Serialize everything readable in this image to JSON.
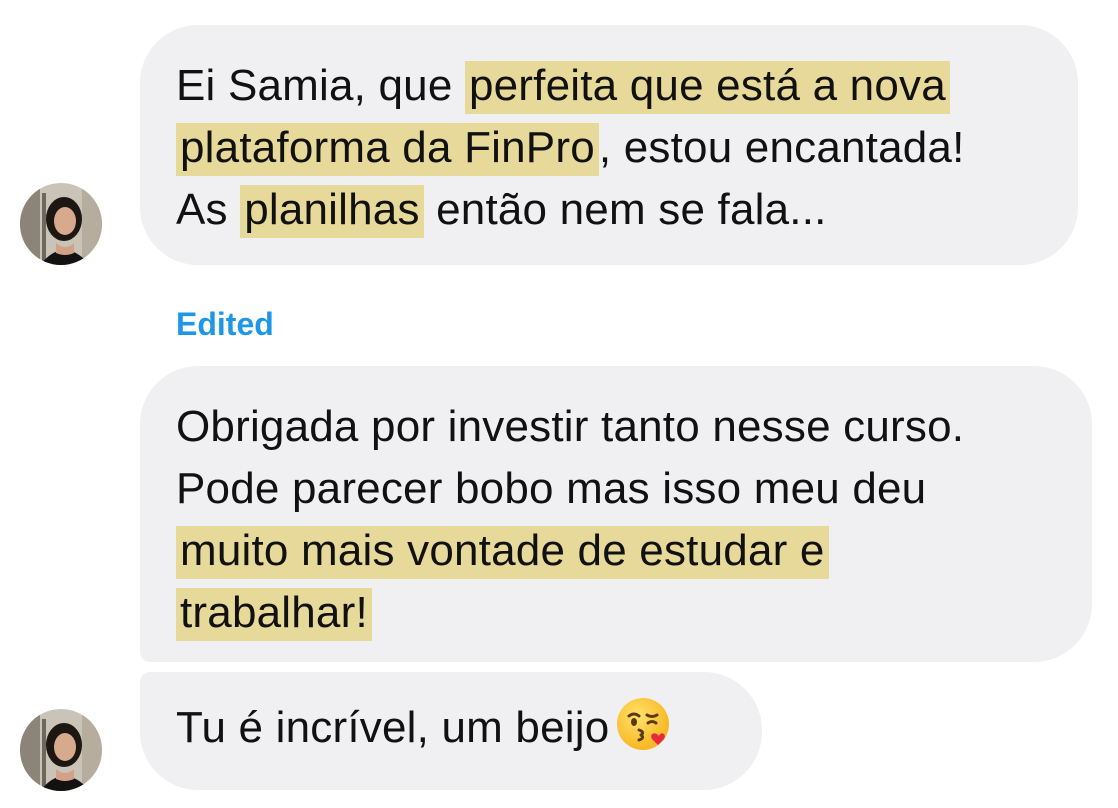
{
  "messages": [
    {
      "parts": [
        {
          "text": "Ei Samia, que "
        },
        {
          "text": "perfeita que está a nova",
          "highlight": true
        },
        {
          "text": "\n"
        },
        {
          "text": "plataforma da FinPro",
          "highlight": true
        },
        {
          "text": ", estou encantada!\nAs "
        },
        {
          "text": "planilhas",
          "highlight": true
        },
        {
          "text": " então nem se fala..."
        }
      ]
    },
    {
      "edited_label": "Edited",
      "parts": [
        {
          "text": "Obrigada por investir tanto nesse curso.\nPode parecer bobo mas isso meu deu\n"
        },
        {
          "text": "muito mais vontade de estudar e ",
          "highlight": true
        },
        {
          "text": "\n"
        },
        {
          "text": "trabalhar! ",
          "highlight": true
        }
      ]
    },
    {
      "parts": [
        {
          "text": "Tu é incrível, um beijo"
        }
      ],
      "emoji": "face-blowing-kiss-icon"
    }
  ],
  "colors": {
    "bubble": "#f0f0f2",
    "highlight": "#e6d99a",
    "edited": "#1f97e8",
    "text": "#111111"
  }
}
